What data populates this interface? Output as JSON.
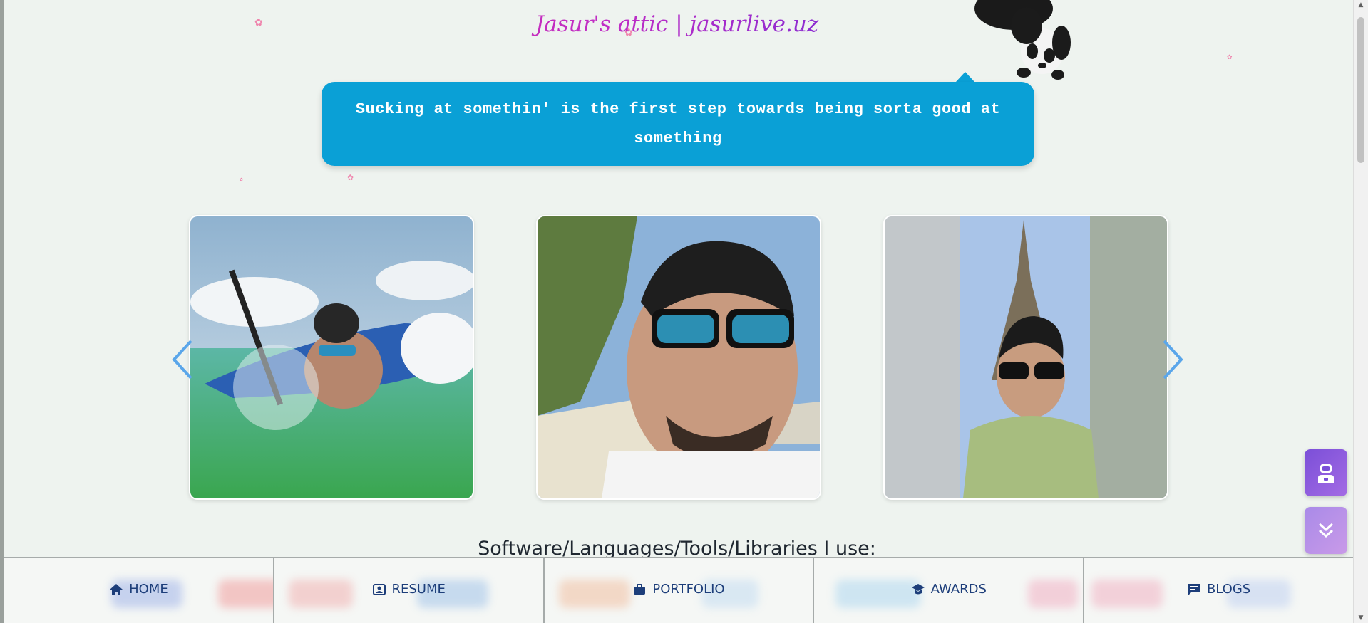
{
  "header": {
    "title": "Jasur's attic | jasurlive.uz"
  },
  "quote": {
    "text": "Sucking at somethin' is the first step towards being sorta good at something"
  },
  "carousel": {
    "prev_icon": "chevron-left-icon",
    "next_icon": "chevron-right-icon",
    "photos": [
      {
        "description": "man paddleboarding in sea"
      },
      {
        "description": "selfie on palm beach"
      },
      {
        "description": "selfie in front of Eiffel Tower"
      }
    ]
  },
  "section": {
    "heading": "Software/Languages/Tools/Libraries I use:"
  },
  "nav": {
    "items": [
      {
        "label": "HOME",
        "icon": "home-icon"
      },
      {
        "label": "RESUME",
        "icon": "resume-icon"
      },
      {
        "label": "PORTFOLIO",
        "icon": "briefcase-icon"
      },
      {
        "label": "AWARDS",
        "icon": "graduation-cap-icon"
      },
      {
        "label": "BLOGS",
        "icon": "message-icon"
      }
    ]
  },
  "fabs": {
    "assistant_icon": "robot-icon",
    "scroll_icon": "double-chevron-down-icon"
  },
  "colors": {
    "bubble": "#0aa0d6",
    "nav_text": "#1d3e7a",
    "background": "#eef3ef",
    "arrow": "#5aa6ea"
  }
}
